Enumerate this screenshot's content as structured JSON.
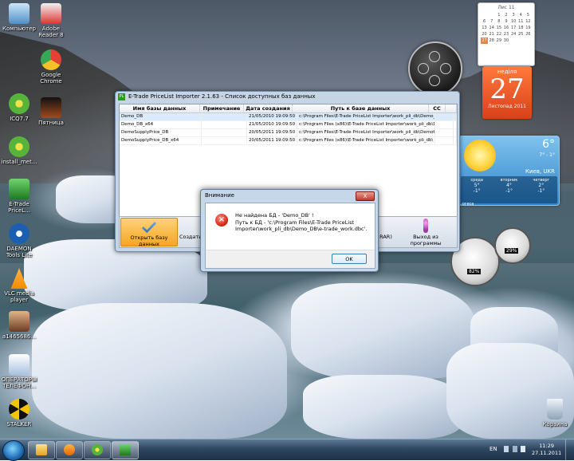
{
  "desktop": {
    "icons": [
      {
        "label": "Компьютер",
        "color": "#7ab6e6"
      },
      {
        "label": "Adobe Reader 8",
        "color": "#c8101e"
      },
      {
        "label": "Google Chrome",
        "color": "#e34133"
      },
      {
        "label": "ICQ7.7",
        "color": "#56b43b"
      },
      {
        "label": "Пятница",
        "color": "#2b2b2b"
      },
      {
        "label": "install_met...",
        "color": "#56b43b"
      },
      {
        "label": "E-Trade PriceL...",
        "color": "#2a9a2a"
      },
      {
        "label": "DAEMON Tools Lite",
        "color": "#1c5fb0"
      },
      {
        "label": "VLC media player",
        "color": "#f28c00"
      },
      {
        "label": "a1465686...",
        "color": "#c48b61"
      },
      {
        "label": "ОПЕРАТОРЫ ТЕЛЕФОН...",
        "color": "#4a79b8"
      },
      {
        "label": "STALKER",
        "color": "#f2c500"
      },
      {
        "label": "Корзина",
        "color": "#b8c7d6"
      }
    ]
  },
  "gadgets": {
    "calendar": {
      "month_label": "Лис 11",
      "days": [
        "",
        "",
        "1",
        "2",
        "3",
        "4",
        "5",
        "6",
        "7",
        "8",
        "9",
        "10",
        "11",
        "12",
        "13",
        "14",
        "15",
        "16",
        "17",
        "18",
        "19",
        "20",
        "21",
        "22",
        "23",
        "24",
        "25",
        "26",
        "27",
        "28",
        "29",
        "30",
        "",
        "",
        "",
        ""
      ],
      "highlight": "27"
    },
    "day_card": {
      "weekday": "неділя",
      "day": "27",
      "month": "Листопад 2011"
    },
    "weather": {
      "temp_now": "6°",
      "temp_range": "7° - 1°",
      "city": "Киев, UKR",
      "forecast": [
        {
          "day": "среда",
          "temp": "5°\n-1°"
        },
        {
          "day": "вторник",
          "temp": "4°\n-1°"
        },
        {
          "day": "четверг",
          "temp": "2°\n-1°"
        }
      ],
      "source": "...огеса"
    },
    "meter": {
      "cpu": "82%",
      "ram": "29%"
    }
  },
  "app": {
    "title": "E-Trade PriceList Importer 2.1.63 - Список доступных баз данных",
    "icon": "PL",
    "columns": [
      "Имя базы данных",
      "Примечание",
      "Дата создания",
      "Путь к базе данных",
      "CC"
    ],
    "rows": [
      {
        "name": "Demo_DB",
        "note": "",
        "date": "21/05/2010 19:09:50",
        "path": "c:\\Program Files\\E-Trade PriceList Importer\\work_pli_db\\Demo_",
        "selected": true
      },
      {
        "name": "Demo_DB_x64",
        "note": "",
        "date": "21/05/2010 19:09:50",
        "path": "c:\\Program Files (x86)\\E-Trade PriceList Importer\\work_pli_db\\Demo",
        "selected": false
      },
      {
        "name": "DemoSupplyPrice_DB",
        "note": "",
        "date": "20/05/2011 19:09:50",
        "path": "c:\\Program Files\\E-Trade PriceList Importer\\work_pli_db\\Demot",
        "selected": false
      },
      {
        "name": "DemoSupplyPrice_DB_x64",
        "note": "",
        "date": "20/05/2011 19:09:50",
        "path": "c:\\Program Files (x86)\\E-Trade PriceList Importer\\work_pli_db\\",
        "selected": false
      }
    ],
    "toolbar": {
      "open": "Открыть базу данных",
      "create": "Создать",
      "middle": "RAR)",
      "exit": "Выход из программы"
    }
  },
  "dialog": {
    "title": "Внимание",
    "close": "X",
    "line1": "Не найдена БД - 'Demo_DB' !",
    "line2": "Путь к БД - 'c:\\Program Files\\E-Trade PriceList Importer\\work_pli_db\\Demo_DB\\e-trade_work.dbc'.",
    "ok": "OK"
  },
  "taskbar": {
    "lang": "EN",
    "time": "11:29",
    "date": "27.11.2011"
  }
}
